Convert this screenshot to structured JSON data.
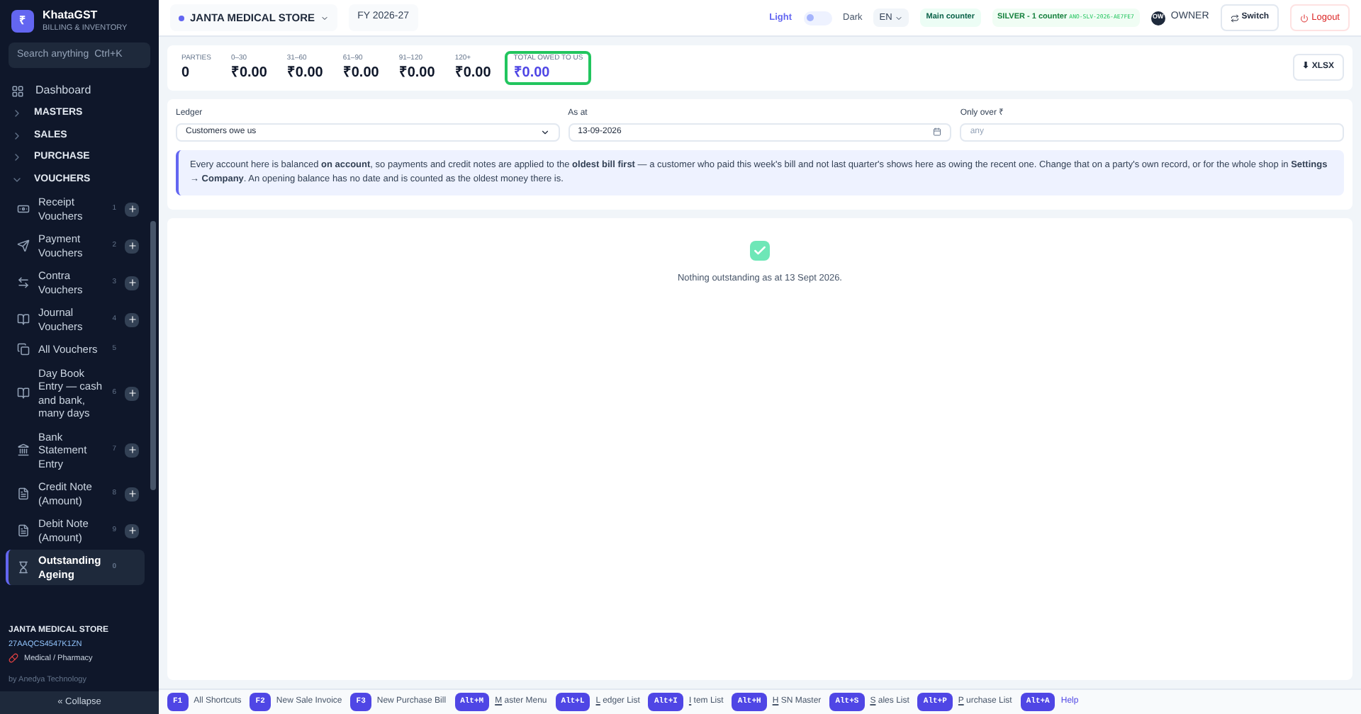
{
  "app": {
    "name": "KhataGST",
    "subtitle": "BILLING & INVENTORY",
    "logo": "₹"
  },
  "search": {
    "placeholder": "Search anything",
    "shortcut": "Ctrl+K"
  },
  "sidebar": {
    "items": [
      {
        "kind": "link",
        "label": "Dashboard",
        "selected": false
      },
      {
        "kind": "group",
        "label": "MASTERS",
        "expanded": false
      },
      {
        "kind": "group",
        "label": "SALES",
        "expanded": false
      },
      {
        "kind": "group",
        "label": "PURCHASE",
        "expanded": false
      },
      {
        "kind": "group",
        "label": "VOUCHERS",
        "expanded": true,
        "children": [
          {
            "label": "Receipt Vouchers",
            "count": "1",
            "add": true,
            "selected": false
          },
          {
            "label": "Payment Vouchers",
            "count": "2",
            "add": true,
            "selected": false
          },
          {
            "label": "Contra Vouchers",
            "count": "3",
            "add": true,
            "selected": false
          },
          {
            "label": "Journal Vouchers",
            "count": "4",
            "add": true,
            "selected": false
          },
          {
            "label": "All Vouchers",
            "count": "5",
            "add": false,
            "selected": false
          },
          {
            "label": "Day Book Entry — cash and bank, many days",
            "count": "6",
            "add": true,
            "selected": false
          },
          {
            "label": "Bank Statement Entry",
            "count": "7",
            "add": true,
            "selected": false
          },
          {
            "label": "Credit Note (Amount)",
            "count": "8",
            "add": true,
            "selected": false
          },
          {
            "label": "Debit Note (Amount)",
            "count": "9",
            "add": true,
            "selected": false
          },
          {
            "label": "Outstanding Ageing",
            "count": "0",
            "add": false,
            "selected": true
          }
        ]
      }
    ]
  },
  "company": {
    "name": "JANTA MEDICAL STORE",
    "gstin": "27AAQCS4547K1ZN",
    "type": "Medical / Pharmacy",
    "credit": "by Anedya Technology",
    "collapse": "« Collapse"
  },
  "header": {
    "store": "JANTA MEDICAL STORE",
    "fy": "FY 2026-27",
    "theme_light": "Light",
    "theme_dark": "Dark",
    "dark_mode": false,
    "language": "EN",
    "counter": "Main counter",
    "plan": "SILVER - 1 counter",
    "plan_code": "ANO-SLV-2026-AE7FE7",
    "user_initials": "OW",
    "user": "OWNER",
    "switch": "Switch",
    "logout": "Logout"
  },
  "stats": [
    {
      "label": "PARTIES",
      "value": "0",
      "selected": false
    },
    {
      "label": "0–30",
      "value": "₹0.00",
      "selected": false
    },
    {
      "label": "31–60",
      "value": "₹0.00",
      "selected": false
    },
    {
      "label": "61–90",
      "value": "₹0.00",
      "selected": false
    },
    {
      "label": "91–120",
      "value": "₹0.00",
      "selected": false
    },
    {
      "label": "120+",
      "value": "₹0.00",
      "selected": false
    },
    {
      "label": "TOTAL OWED TO US",
      "value": "₹0.00",
      "selected": true
    }
  ],
  "export": "⬇ XLSX",
  "filters": {
    "ledger_label": "Ledger",
    "ledger": "Customers owe us",
    "as_at_label": "As at",
    "as_at": "13-09-2026",
    "over_label": "Only over ₹",
    "over_placeholder": "any"
  },
  "info": "Every account here is balanced **on account**, so payments and credit notes are applied to the **oldest bill first** — a customer who paid this week's bill and not last quarter's shows here as owing the recent one. Change that on a party's own record, or for the whole shop in **Settings → Company**. An opening balance has no date and is counted as the oldest money there is.",
  "empty": "Nothing outstanding as at 13 Sept 2026.",
  "shortcuts": [
    {
      "key": "F1",
      "rest": "All Shortcuts"
    },
    {
      "key": "F2",
      "rest": "New Sale Invoice"
    },
    {
      "key": "F3",
      "rest": "New Purchase Bill"
    },
    {
      "key": "Alt+M",
      "hotkey": "M",
      "rest": "aster Menu"
    },
    {
      "key": "Alt+L",
      "hotkey": "L",
      "rest": "edger List"
    },
    {
      "key": "Alt+I",
      "hotkey": "I",
      "rest": "tem List"
    },
    {
      "key": "Alt+H",
      "hotkey": "H",
      "rest": "SN Master"
    },
    {
      "key": "Alt+S",
      "hotkey": "S",
      "rest": "ales List"
    },
    {
      "key": "Alt+P",
      "hotkey": "P",
      "rest": "urchase List"
    },
    {
      "key": "Alt+A",
      "rest": "Help",
      "link": true
    }
  ]
}
